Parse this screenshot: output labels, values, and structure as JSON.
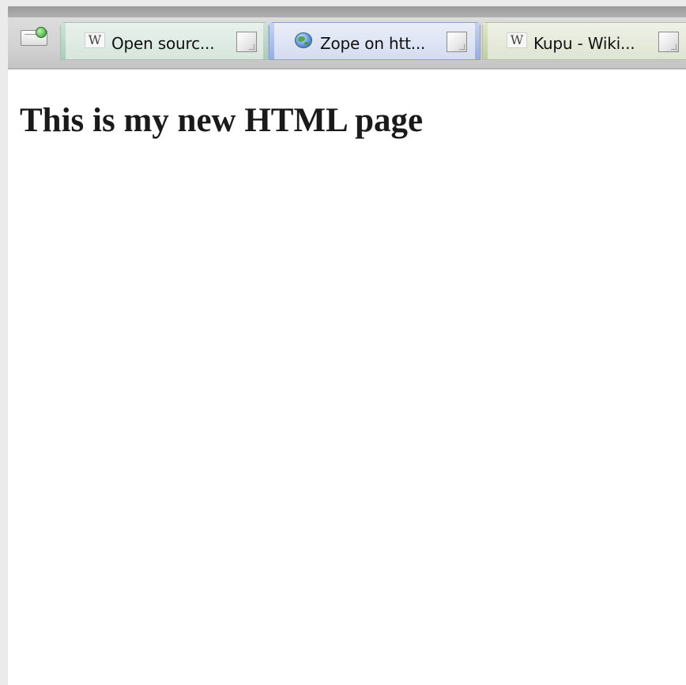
{
  "browser": {
    "new_tab_icon": "new-tab-icon",
    "tabs": [
      {
        "label": "Open sourc...",
        "icon": "wikipedia-icon",
        "icon_glyph": "W",
        "accent": "#a9cdb8"
      },
      {
        "label": "Zope on htt...",
        "icon": "globe-icon",
        "accent": "#97aee3"
      },
      {
        "label": "Kupu - Wiki...",
        "icon": "wikipedia-icon",
        "icon_glyph": "W",
        "accent": "#c2cda2"
      }
    ]
  },
  "page": {
    "heading": "This is my new HTML page"
  }
}
